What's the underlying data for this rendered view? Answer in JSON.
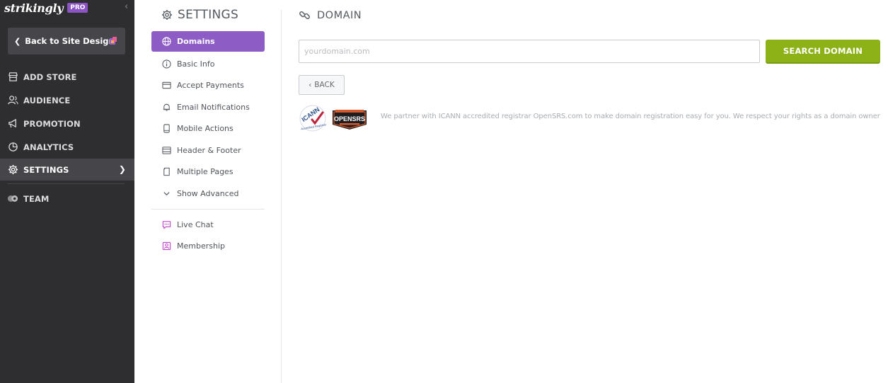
{
  "brand": {
    "logo_text": "strikingly",
    "badge": "PRO"
  },
  "sidebar": {
    "back_label": "Back to Site Design",
    "items": [
      {
        "label": "ADD STORE",
        "icon": "store-icon"
      },
      {
        "label": "AUDIENCE",
        "icon": "audience-icon"
      },
      {
        "label": "PROMOTION",
        "icon": "megaphone-icon"
      },
      {
        "label": "ANALYTICS",
        "icon": "pie-chart-icon"
      },
      {
        "label": "SETTINGS",
        "icon": "gear-icon",
        "active": true
      },
      {
        "label": "TEAM",
        "icon": "team-icon"
      }
    ]
  },
  "settings": {
    "title": "SETTINGS",
    "menu": [
      {
        "label": "Domains",
        "icon": "globe-icon",
        "active": true
      },
      {
        "label": "Basic Info",
        "icon": "info-icon"
      },
      {
        "label": "Accept Payments",
        "icon": "card-icon"
      },
      {
        "label": "Email Notifications",
        "icon": "bell-icon"
      },
      {
        "label": "Mobile Actions",
        "icon": "mobile-icon"
      },
      {
        "label": "Header & Footer",
        "icon": "layout-icon"
      },
      {
        "label": "Multiple Pages",
        "icon": "pages-icon"
      },
      {
        "label": "Show Advanced",
        "icon": "chevron-down-icon"
      }
    ],
    "menu2": [
      {
        "label": "Live Chat",
        "icon": "chat-icon"
      },
      {
        "label": "Membership",
        "icon": "membership-icon"
      }
    ]
  },
  "domain": {
    "title": "DOMAIN",
    "input_placeholder": "yourdomain.com",
    "input_value": "",
    "search_label": "SEARCH DOMAIN",
    "back_label": "BACK",
    "partner_text": "We partner with ICANN accredited registrar OpenSRS.com to make domain registration easy for you. We respect your rights as a domain owner",
    "icann_logo_text": "ICANN",
    "icann_logo_subtext": "Accredited Registrar",
    "opensrs_logo_text": "OPENSRS"
  },
  "colors": {
    "sidebar_bg": "#2e2e31",
    "accent_purple": "#8d5cc5",
    "search_green": "#8cb218"
  }
}
